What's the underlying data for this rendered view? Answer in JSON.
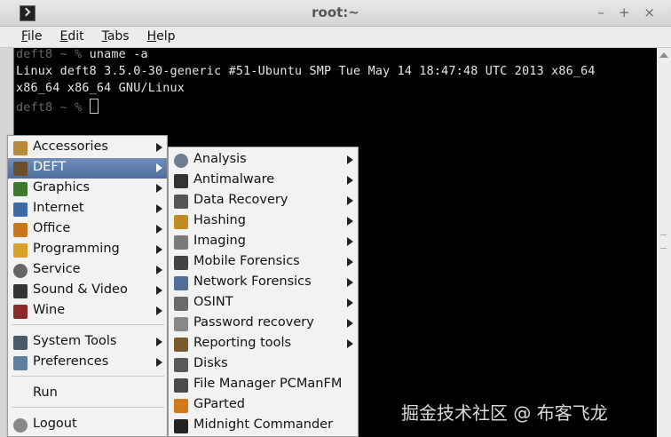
{
  "window": {
    "title": "root:~"
  },
  "menubar": [
    "File",
    "Edit",
    "Tabs",
    "Help"
  ],
  "terminal": {
    "line1_prompt": "deft8 ~ % ",
    "line1_cmd": "uname -a",
    "line2": "Linux deft8 3.5.0-30-generic #51-Ubuntu SMP Tue May 14 18:47:48 UTC 2013 x86_64",
    "line3": "x86_64 x86_64 GNU/Linux",
    "line4_prompt": "deft8 ~ % "
  },
  "main_menu": {
    "items": [
      {
        "label": "Accessories",
        "icon": "accessories-icon",
        "color": "#b58a3a"
      },
      {
        "label": "DEFT",
        "icon": "deft-icon",
        "color": "#6b4e2e"
      },
      {
        "label": "Graphics",
        "icon": "graphics-icon",
        "color": "#3d7a2e"
      },
      {
        "label": "Internet",
        "icon": "internet-icon",
        "color": "#3b6aa8"
      },
      {
        "label": "Office",
        "icon": "office-icon",
        "color": "#c9771b"
      },
      {
        "label": "Programming",
        "icon": "programming-icon",
        "color": "#d9a12a"
      },
      {
        "label": "Service",
        "icon": "service-icon",
        "color": "#666666"
      },
      {
        "label": "Sound & Video",
        "icon": "sound-video-icon",
        "color": "#333333"
      },
      {
        "label": "Wine",
        "icon": "wine-icon",
        "color": "#8a2b2b"
      },
      {
        "label": "System Tools",
        "icon": "system-tools-icon",
        "color": "#4a5a6a"
      },
      {
        "label": "Preferences",
        "icon": "preferences-icon",
        "color": "#5e7f9e"
      },
      {
        "label": "Run",
        "icon": "",
        "color": ""
      },
      {
        "label": "Logout",
        "icon": "logout-icon",
        "color": "#888888"
      }
    ]
  },
  "deft_submenu": {
    "items": [
      {
        "label": "Analysis",
        "icon": "magnifier-icon",
        "color": "#6d7e90"
      },
      {
        "label": "Antimalware",
        "icon": "antimalware-icon",
        "color": "#333333"
      },
      {
        "label": "Data Recovery",
        "icon": "data-recovery-icon",
        "color": "#555555"
      },
      {
        "label": "Hashing",
        "icon": "hashing-icon",
        "color": "#c08a20"
      },
      {
        "label": "Imaging",
        "icon": "imaging-icon",
        "color": "#7a7a7a"
      },
      {
        "label": "Mobile Forensics",
        "icon": "mobile-icon",
        "color": "#444444"
      },
      {
        "label": "Network Forensics",
        "icon": "network-icon",
        "color": "#4d6f99"
      },
      {
        "label": "OSINT",
        "icon": "osint-icon",
        "color": "#6a6a6a"
      },
      {
        "label": "Password recovery",
        "icon": "lock-icon",
        "color": "#888888"
      },
      {
        "label": "Reporting tools",
        "icon": "reporting-icon",
        "color": "#7a5a2a"
      },
      {
        "label": "Disks",
        "icon": "disks-icon",
        "color": "#5a5a5a"
      },
      {
        "label": "File Manager PCManFM",
        "icon": "file-manager-icon",
        "color": "#4a4a4a"
      },
      {
        "label": "GParted",
        "icon": "gparted-icon",
        "color": "#d07a1a"
      },
      {
        "label": "Midnight Commander",
        "icon": "midnight-commander-icon",
        "color": "#222222"
      }
    ]
  },
  "watermark": "掘金技术社区 @ 布客飞龙"
}
